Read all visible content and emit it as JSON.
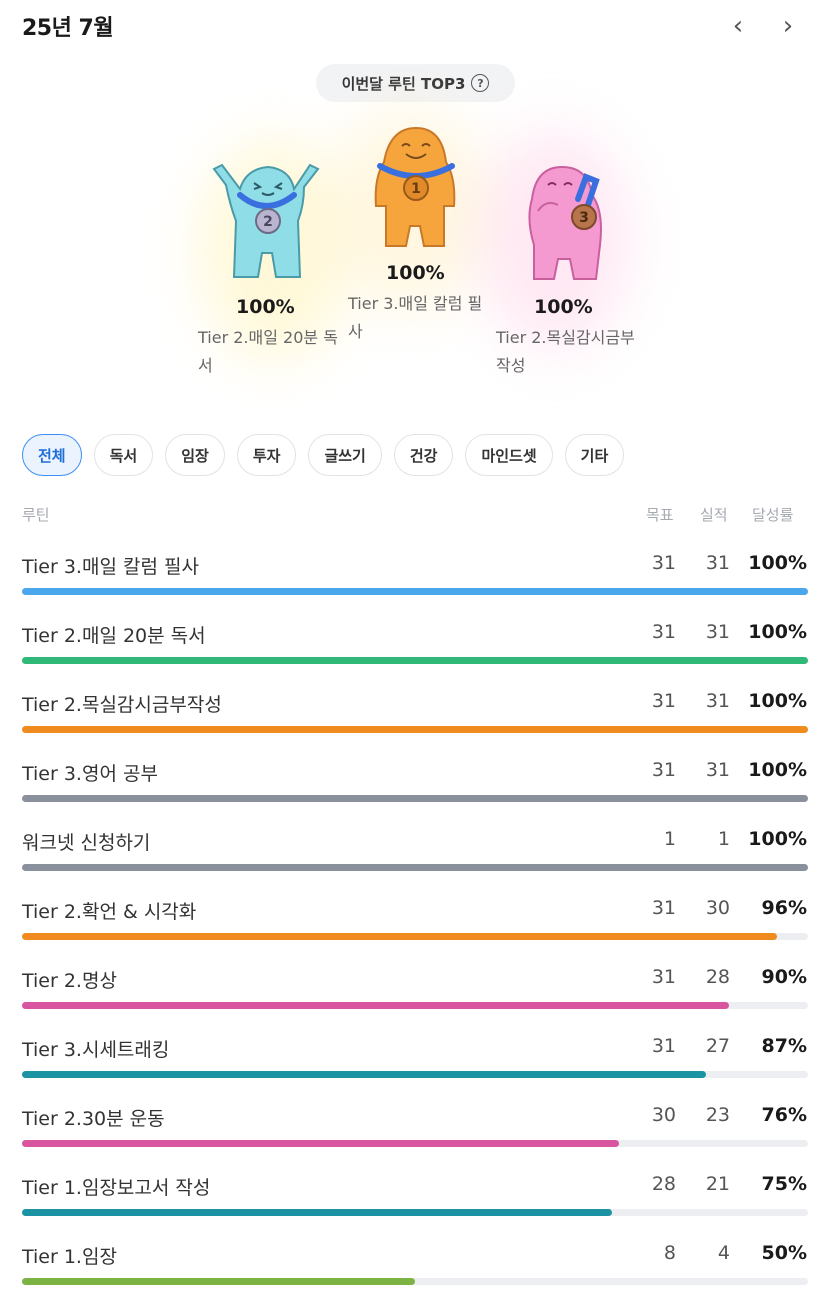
{
  "header": {
    "title": "25년 7월",
    "prev_icon": "‹",
    "next_icon": "›"
  },
  "top3": {
    "badge_label": "이번달 루틴 TOP3",
    "help_glyph": "?",
    "ranks": [
      {
        "rank": "1",
        "percent": "100%",
        "label": "Tier 3.매일 칼럼 필사",
        "color": "#f5a53c",
        "medal": "#e08a2a"
      },
      {
        "rank": "2",
        "percent": "100%",
        "label": "Tier 2.매일 20분 독서",
        "color": "#8fdde6",
        "medal": "#b9b4cf"
      },
      {
        "rank": "3",
        "percent": "100%",
        "label": "Tier 2.목실감시금부작성",
        "color": "#f59ad1",
        "medal": "#b8744a"
      }
    ]
  },
  "filters": [
    "전체",
    "독서",
    "임장",
    "투자",
    "글쓰기",
    "건강",
    "마인드셋",
    "기타"
  ],
  "active_filter": "전체",
  "table": {
    "headers": {
      "routine": "루틴",
      "goal": "목표",
      "done": "실적",
      "rate": "달성률"
    },
    "rows": [
      {
        "name": "Tier 3.매일 칼럼 필사",
        "goal": "31",
        "done": "31",
        "rate": "100%",
        "progress": 1.0,
        "color": "#4aa7ec"
      },
      {
        "name": "Tier 2.매일 20분 독서",
        "goal": "31",
        "done": "31",
        "rate": "100%",
        "progress": 1.0,
        "color": "#2fb877"
      },
      {
        "name": "Tier 2.목실감시금부작성",
        "goal": "31",
        "done": "31",
        "rate": "100%",
        "progress": 1.0,
        "color": "#f08c1f"
      },
      {
        "name": "Tier 3.영어 공부",
        "goal": "31",
        "done": "31",
        "rate": "100%",
        "progress": 1.0,
        "color": "#8a919c"
      },
      {
        "name": "워크넷 신청하기",
        "goal": "1",
        "done": "1",
        "rate": "100%",
        "progress": 1.0,
        "color": "#8a919c"
      },
      {
        "name": "Tier 2.확언 & 시각화",
        "goal": "31",
        "done": "30",
        "rate": "96%",
        "progress": 0.96,
        "color": "#f08c1f"
      },
      {
        "name": "Tier 2.명상",
        "goal": "31",
        "done": "28",
        "rate": "90%",
        "progress": 0.9,
        "color": "#d9559f"
      },
      {
        "name": "Tier 3.시세트래킹",
        "goal": "31",
        "done": "27",
        "rate": "87%",
        "progress": 0.87,
        "color": "#1b93a3"
      },
      {
        "name": "Tier 2.30분 운동",
        "goal": "30",
        "done": "23",
        "rate": "76%",
        "progress": 0.76,
        "color": "#d9559f"
      },
      {
        "name": "Tier 1.임장보고서 작성",
        "goal": "28",
        "done": "21",
        "rate": "75%",
        "progress": 0.75,
        "color": "#1b93a3"
      },
      {
        "name": "Tier 1.임장",
        "goal": "8",
        "done": "4",
        "rate": "50%",
        "progress": 0.5,
        "color": "#7cb342"
      }
    ]
  }
}
